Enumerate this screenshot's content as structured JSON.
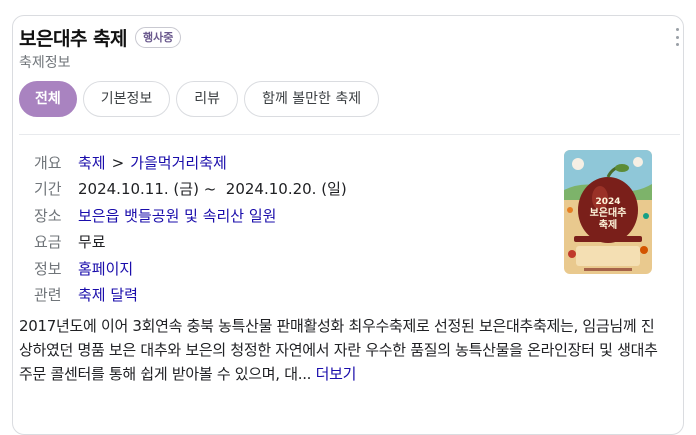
{
  "header": {
    "title": "보은대추 축제",
    "badge": "행사중",
    "subtitle": "축제정보"
  },
  "tabs": [
    {
      "label": "전체",
      "active": true
    },
    {
      "label": "기본정보",
      "active": false
    },
    {
      "label": "리뷰",
      "active": false
    },
    {
      "label": "함께 볼만한 축제",
      "active": false
    }
  ],
  "info": {
    "overview": {
      "key": "개요",
      "cat1": "축제",
      "sep": ">",
      "cat2": "가을먹거리축제"
    },
    "period": {
      "key": "기간",
      "value": "2024.10.11. (금) ~  2024.10.20. (일)"
    },
    "place": {
      "key": "장소",
      "value": "보은읍 뱃들공원 및 속리산 일원"
    },
    "fee": {
      "key": "요금",
      "value": "무료"
    },
    "homepage": {
      "key": "정보",
      "value": "홈페이지"
    },
    "related": {
      "key": "관련",
      "value": "축제 달력"
    }
  },
  "poster": {
    "text": "2024 보은대추 축제",
    "icon": "festival-poster-image"
  },
  "description": {
    "text": "2017년도에 이어 3회연속 충북 농특산물 판매활성화 최우수축제로 선정된 보은대추축제는, 임금님께 진상하였던 명품 보은 대추와 보은의 청정한 자연에서 자란 우수한 품질의 농특산물을 온라인장터 및 생대추 주문 콜센터를 통해 쉽게 받아볼 수 있으며, 대...",
    "more": "더보기"
  },
  "colors": {
    "accent": "#a983c0",
    "link": "#1a0dab",
    "muted": "#70757a"
  }
}
